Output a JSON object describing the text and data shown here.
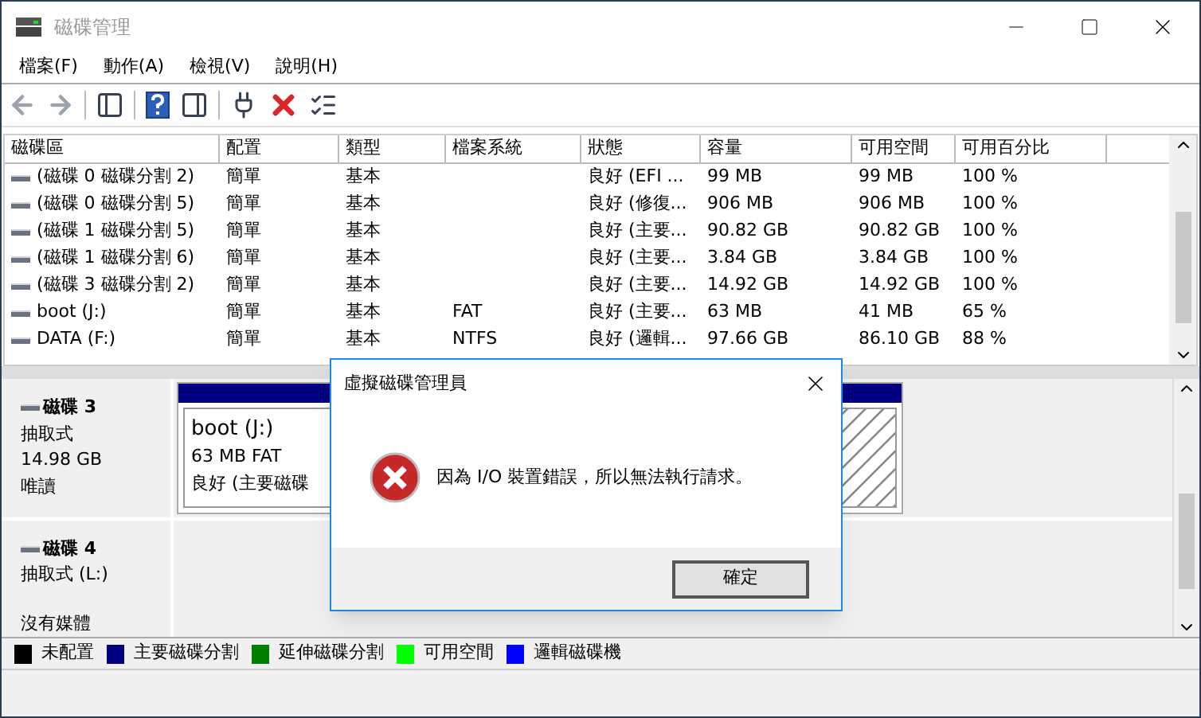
{
  "window": {
    "title": "磁碟管理"
  },
  "menu": [
    "檔案(F)",
    "動作(A)",
    "檢視(V)",
    "說明(H)"
  ],
  "toolbar": [
    {
      "kind": "back",
      "disabled": true
    },
    {
      "kind": "forward",
      "disabled": true
    },
    {
      "kind": "tree",
      "disabled": false
    },
    {
      "kind": "help",
      "disabled": false
    },
    {
      "kind": "pane",
      "disabled": false
    },
    {
      "kind": "connect",
      "disabled": false
    },
    {
      "kind": "delete",
      "disabled": false
    },
    {
      "kind": "properties",
      "disabled": false
    }
  ],
  "volume_table": {
    "columns": [
      "磁碟區",
      "配置",
      "類型",
      "檔案系統",
      "狀態",
      "容量",
      "可用空間",
      "可用百分比"
    ],
    "rows": [
      [
        "(磁碟 0 磁碟分割 2)",
        "簡單",
        "基本",
        "",
        "良好 (EFI ...",
        "99 MB",
        "99 MB",
        "100 %"
      ],
      [
        "(磁碟 0 磁碟分割 5)",
        "簡單",
        "基本",
        "",
        "良好 (修復...",
        "906 MB",
        "906 MB",
        "100 %"
      ],
      [
        "(磁碟 1 磁碟分割 5)",
        "簡單",
        "基本",
        "",
        "良好 (主要...",
        "90.82 GB",
        "90.82 GB",
        "100 %"
      ],
      [
        "(磁碟 1 磁碟分割 6)",
        "簡單",
        "基本",
        "",
        "良好 (主要...",
        "3.84 GB",
        "3.84 GB",
        "100 %"
      ],
      [
        "(磁碟 3 磁碟分割 2)",
        "簡單",
        "基本",
        "",
        "良好 (主要...",
        "14.92 GB",
        "14.92 GB",
        "100 %"
      ],
      [
        "boot (J:)",
        "簡單",
        "基本",
        "FAT",
        "良好 (主要...",
        "63 MB",
        "41 MB",
        "65 %"
      ],
      [
        "DATA (F:)",
        "簡單",
        "基本",
        "NTFS",
        "良好 (邏輯...",
        "97.66 GB",
        "86.10 GB",
        "88 %"
      ]
    ]
  },
  "disks": [
    {
      "name": "磁碟 3",
      "type": "抽取式",
      "size": "14.98 GB",
      "status": "唯讀",
      "partitions": [
        {
          "kind": "primary",
          "name": "boot  (J:)",
          "size": "63 MB FAT",
          "status": "良好 (主要磁碟"
        },
        {
          "kind": "unknown"
        }
      ]
    },
    {
      "name": "磁碟 4",
      "type": "抽取式 (L:)",
      "status": "沒有媒體"
    }
  ],
  "legend": [
    {
      "label": "未配置",
      "color": "#000000"
    },
    {
      "label": "主要磁碟分割",
      "color": "#000080"
    },
    {
      "label": "延伸磁碟分割",
      "color": "#008000"
    },
    {
      "label": "可用空間",
      "color": "#00ff00"
    },
    {
      "label": "邏輯磁碟機",
      "color": "#0000ff"
    }
  ],
  "dialog": {
    "title": "虛擬磁碟管理員",
    "message": "因為 I/O 裝置錯誤，所以無法執行請求。",
    "button": "確定"
  }
}
